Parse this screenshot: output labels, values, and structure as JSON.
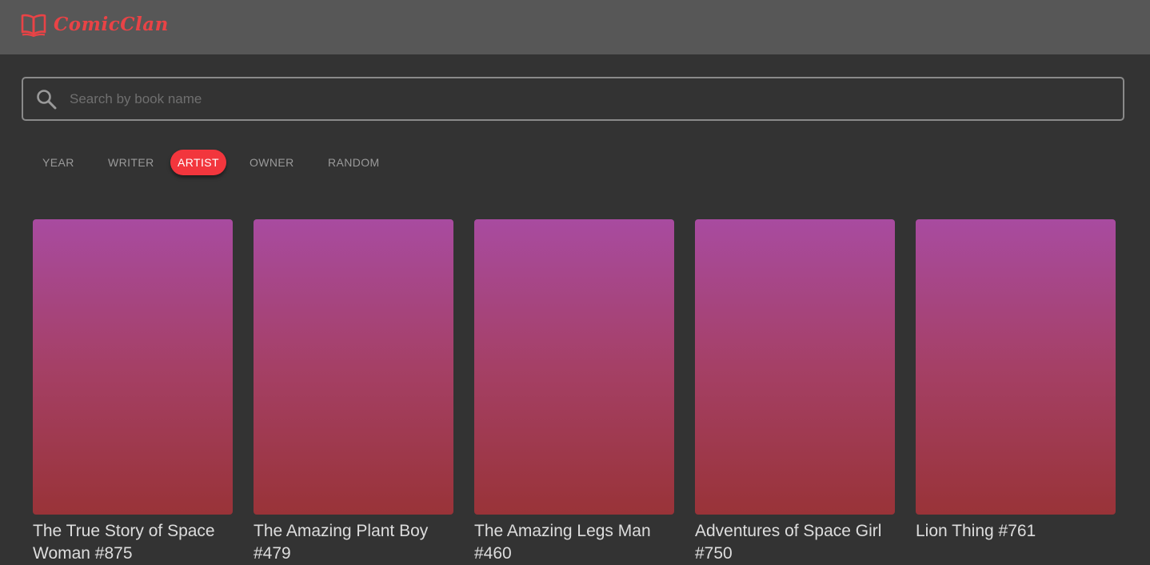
{
  "header": {
    "brand": "ComicClan",
    "logo_icon": "open-book-icon",
    "brand_color": "#e94346"
  },
  "search": {
    "placeholder": "Search by book name",
    "value": "",
    "icon": "search-icon"
  },
  "filters": {
    "active": "ARTIST",
    "active_color": "#f2363d",
    "items": [
      {
        "label": "YEAR"
      },
      {
        "label": "WRITER"
      },
      {
        "label": "ARTIST"
      },
      {
        "label": "OWNER"
      },
      {
        "label": "RANDOM"
      }
    ]
  },
  "books": [
    {
      "title": "The True Story of Space Woman #875"
    },
    {
      "title": "The Amazing Plant Boy #479"
    },
    {
      "title": "The Amazing Legs Man #460"
    },
    {
      "title": "Adventures of Space Girl #750"
    },
    {
      "title": "Lion Thing #761"
    }
  ],
  "colors": {
    "page_background": "#333333",
    "topbar_background": "#575757",
    "cover_gradient": [
      "#a84ba0",
      "#a54066",
      "#993338"
    ]
  }
}
